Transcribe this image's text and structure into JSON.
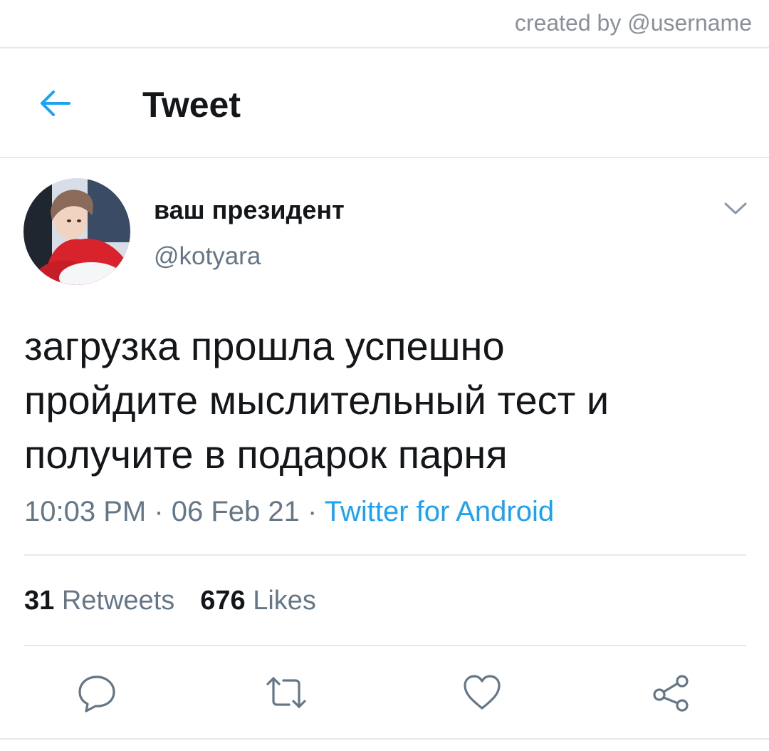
{
  "credit": "created by @username",
  "header": {
    "title": "Tweet",
    "back_icon": "back-arrow-icon"
  },
  "author": {
    "display_name": "ваш президент",
    "handle": "@kotyara"
  },
  "tweet": {
    "lines": [
      "загрузка прошла успешно",
      "пройдите мыслительный тест и",
      "получите в подарок парня"
    ],
    "time": "10:03 PM",
    "date": "06 Feb 21",
    "separator": " · ",
    "source": "Twitter for Android"
  },
  "stats": {
    "retweets_count": "31",
    "retweets_label": "Retweets",
    "likes_count": "676",
    "likes_label": "Likes"
  },
  "actions": [
    "reply-icon",
    "retweet-icon",
    "heart-icon",
    "share-icon"
  ],
  "colors": {
    "accent": "#1da1f2",
    "secondary": "#657786",
    "divider": "#e6e9ec"
  }
}
